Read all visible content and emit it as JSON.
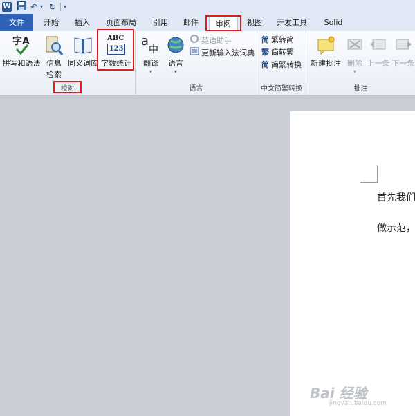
{
  "qat": {
    "logo_text": "W",
    "undo_glyph": "↶",
    "redo_glyph": "↻",
    "dropdown_glyph": "▾"
  },
  "tabs": [
    {
      "label": "文件"
    },
    {
      "label": "开始"
    },
    {
      "label": "插入"
    },
    {
      "label": "页面布局"
    },
    {
      "label": "引用"
    },
    {
      "label": "邮件"
    },
    {
      "label": "审阅"
    },
    {
      "label": "视图"
    },
    {
      "label": "开发工具"
    },
    {
      "label": "Solid"
    }
  ],
  "groups": {
    "proofing": {
      "label": "校对",
      "spelling": "拼写和语法",
      "spelling_icon_text": "字A",
      "research_1": "信息",
      "research_2": "检索",
      "thesaurus": "同义词库",
      "wordcount": "字数统计",
      "wordcount_icon_top": "ABC",
      "wordcount_icon_bottom": "123"
    },
    "language": {
      "label": "语言",
      "translate": "翻译",
      "translate_icon_a": "a",
      "translate_icon_b": "中",
      "language": "语言",
      "english_assistant": "英语助手",
      "update_ime": "更新输入法词典"
    },
    "chinese": {
      "label": "中文简繁转换",
      "to_simplified": "繁转简",
      "to_traditional": "简转繁",
      "convert": "简繁转换",
      "icon_1": "简",
      "icon_2": "繁",
      "icon_3": "简"
    },
    "comments": {
      "label": "批注",
      "new_comment": "新建批注",
      "delete": "删除",
      "previous": "上一条",
      "next": "下一条"
    }
  },
  "document": {
    "line1": "首先我们",
    "line2": "做示范，"
  },
  "watermark": {
    "brand": "Bai 经验",
    "url": "jingyan.baidu.com"
  }
}
